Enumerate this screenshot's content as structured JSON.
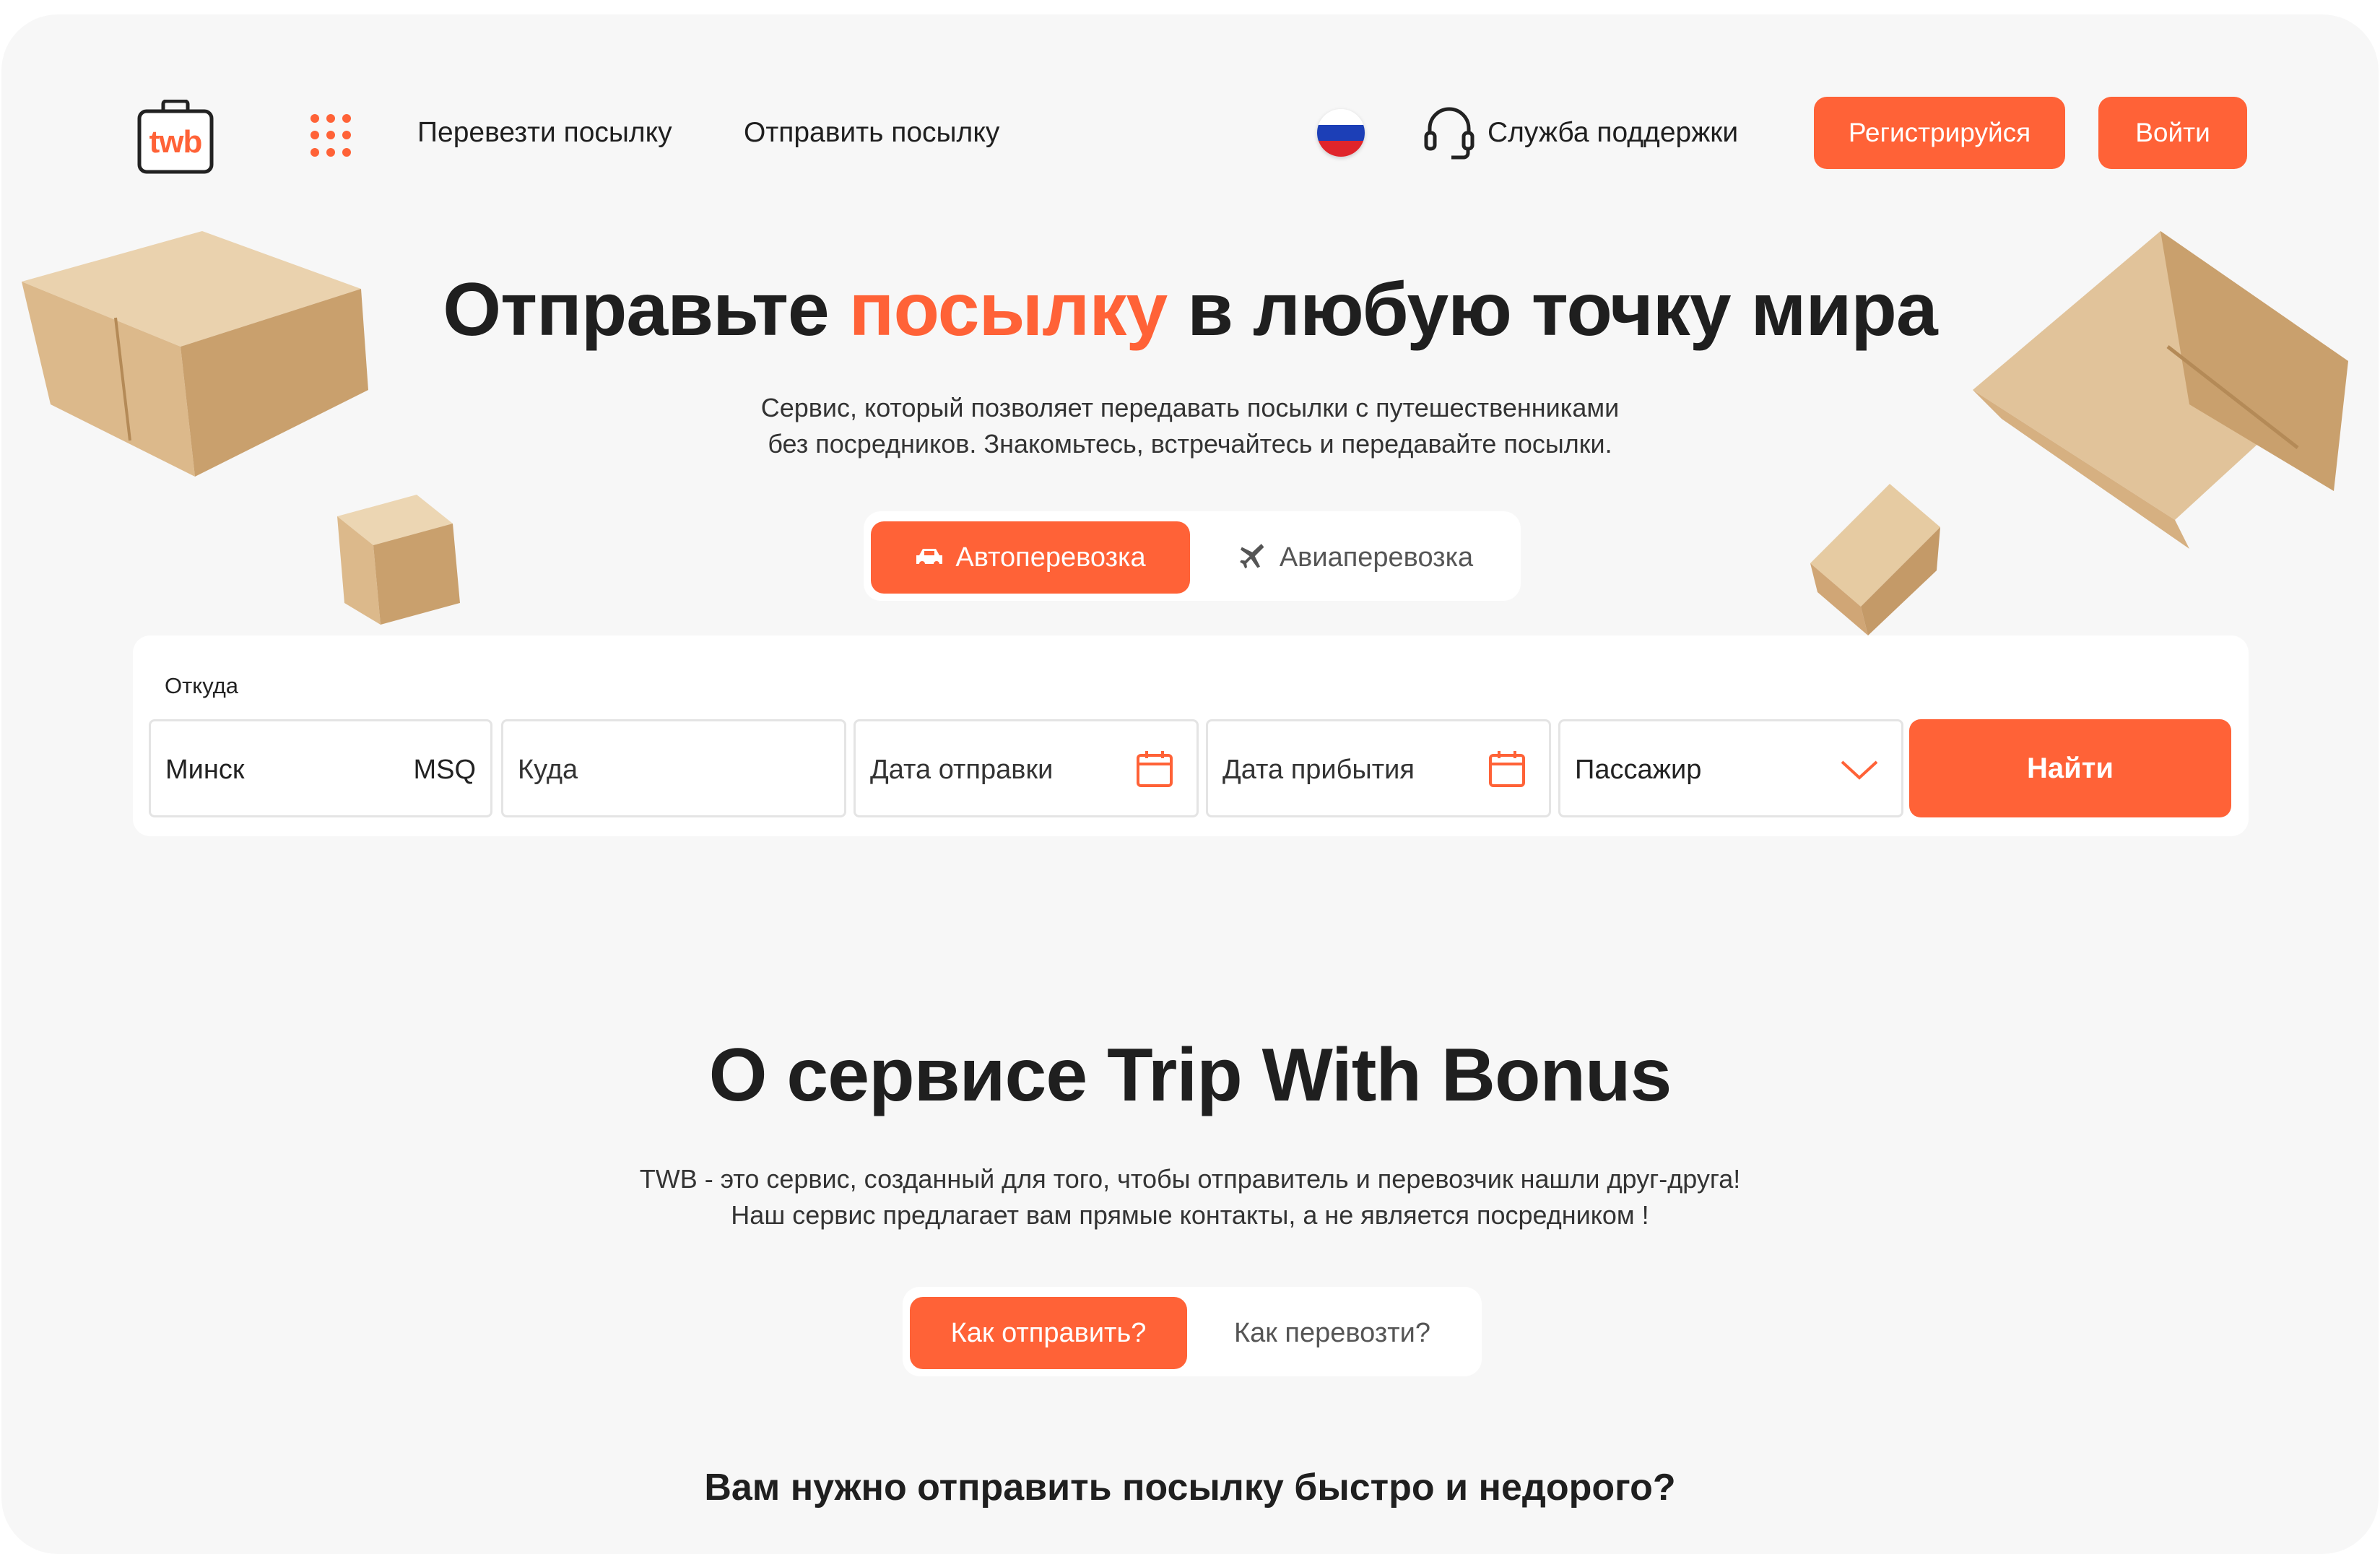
{
  "header": {
    "logo_text": "twb",
    "nav": [
      "Перевезти посылку",
      "Отправить посылку"
    ],
    "support_label": "Служба поддержки",
    "register_label": "Регистрируйся",
    "login_label": "Войти"
  },
  "hero": {
    "title_before": "Отправьте ",
    "title_accent": "посылку",
    "title_after": " в любую точку мира",
    "subtitle_line1": "Сервис, который позволяет передавать посылки с путешественниками",
    "subtitle_line2": "без посредников. Знакомьтесь, встречайтесь и передавайте посылки."
  },
  "transport_tabs": {
    "active": "Автоперевозка",
    "inactive": "Авиаперевозка"
  },
  "search": {
    "from_label": "Откуда",
    "from_value": "Минск",
    "from_code": "MSQ",
    "to_placeholder": "Куда",
    "departure_placeholder": "Дата отправки",
    "arrival_placeholder": "Дата прибытия",
    "role_value": "Пассажир",
    "find_label": "Найти"
  },
  "about": {
    "title": "О сервисе Trip With Bonus",
    "text_line1": "TWB  - это сервис, созданный для того, чтобы отправитель и перевозчик нашли друг-друга!",
    "text_line2": "Наш сервис предлагает вам прямые контакты, а не является посредником !",
    "tab_active": "Как отправить?",
    "tab_inactive": "Как перевозти?",
    "question": "Вам нужно отправить посылку быстро и недорого?"
  },
  "colors": {
    "accent": "#ff6237",
    "background": "#f7f7f7",
    "text": "#1f1f1f"
  },
  "icons": [
    "apps-grid-icon",
    "russia-flag-icon",
    "headset-icon",
    "car-icon",
    "plane-icon",
    "calendar-icon",
    "chevron-down-icon"
  ]
}
